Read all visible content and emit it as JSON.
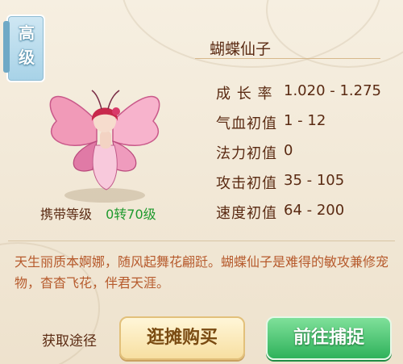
{
  "grade": "高级",
  "pet": {
    "name": "蝴蝶仙子"
  },
  "stats": [
    {
      "label": "成 长 率",
      "value": "1.020 - 1.275"
    },
    {
      "label": "气血初值",
      "value": "1 - 12"
    },
    {
      "label": "法力初值",
      "value": "0"
    },
    {
      "label": "攻击初值",
      "value": "35 - 105"
    },
    {
      "label": "速度初值",
      "value": "64 - 200"
    }
  ],
  "carry": {
    "label": "携带等级",
    "value": "0转70级"
  },
  "description": "天生丽质本婀娜，随风起舞花翩跹。蝴蝶仙子是难得的敏攻兼修宠物，杳杳飞花，伴君天涯。",
  "obtain": {
    "label": "获取途径",
    "stall_button": "逛摊购买",
    "capture_button": "前往捕捉"
  },
  "colors": {
    "label_text": "#5a2a12",
    "carry_value": "#1f9a2e",
    "description_text": "#b65a2c",
    "capture_button": "#2fb25b",
    "stall_button": "#f7dfa1"
  }
}
